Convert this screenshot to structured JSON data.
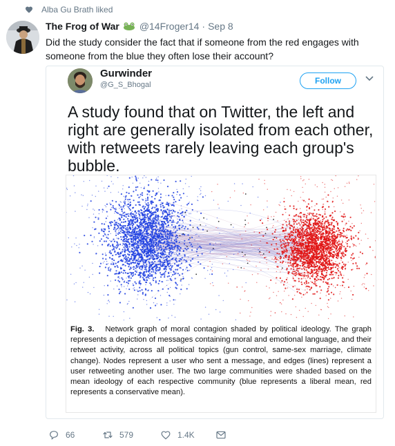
{
  "social_context": {
    "text": "Alba Gu Brath liked",
    "icon": "heart-icon"
  },
  "tweet": {
    "display_name": "The Frog of War",
    "emoji": "frog-emoji",
    "handle": "@14Froger14",
    "separator": "·",
    "time": "Sep 8",
    "text": "Did the study consider the fact that if someone from the red engages with someone from the blue they often lose their account?"
  },
  "quoted_tweet": {
    "display_name": "Gurwinder",
    "handle": "@G_S_Bhogal",
    "follow_label": "Follow",
    "text": "A study found that on Twitter, the left and right are generally isolated from each other, with retweets rarely leaving each group's bubble.",
    "figure": {
      "label": "Fig. 3.",
      "caption": "Network graph of moral contagion shaded by political ideology. The graph represents a depiction of messages containing moral and emotional language, and their retweet activity, across all political topics (gun control, same-sex marriage, climate change). Nodes represent a user who sent a message, and edges (lines) represent a user retweeting another user. The two large communities were shaded based on the mean ideology of each respective community (blue represents a liberal mean, red represents a conservative mean).",
      "colors": {
        "liberal": "#1f3fe0",
        "conservative": "#e01414"
      }
    }
  },
  "actions": {
    "replies": "66",
    "retweets": "579",
    "likes": "1.4K"
  },
  "colors": {
    "brand": "#1da1f2",
    "muted": "#657786",
    "text": "#14171a"
  }
}
